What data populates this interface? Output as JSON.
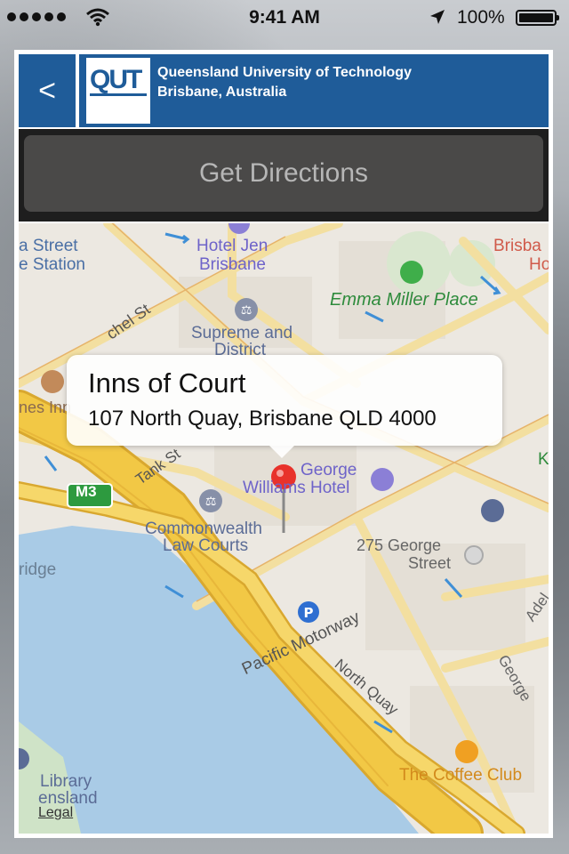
{
  "status_bar": {
    "time": "9:41 AM",
    "battery_pct": "100%",
    "icons": [
      "signal-dots",
      "wifi-icon",
      "location-arrow-icon",
      "battery-icon"
    ]
  },
  "header": {
    "back_label": "<",
    "logo_text": "QUT",
    "line1": "Queensland University of Technology",
    "line2": "Brisbane, Australia"
  },
  "directions_button": "Get Directions",
  "callout": {
    "title": "Inns of Court",
    "address": "107 North Quay, Brisbane QLD 4000"
  },
  "map": {
    "legal": "Legal",
    "labels": {
      "street_station_1": "a Street",
      "street_station_2": "e Station",
      "hotel_jen_1": "Hotel Jen",
      "hotel_jen_2": "Brisbane",
      "brisbane_cut_1": "Brisba",
      "brisbane_cut_2": "Ho",
      "emma_miller": "Emma Miller Place",
      "mitchell_st": "chel St",
      "supreme_1": "Supreme and",
      "supreme_2": "District",
      "inns_cut": "nes Inn",
      "george_williams_1": "George",
      "george_williams_2": "Williams Hotel",
      "tank_st": "Tank St",
      "m3": "M3",
      "commonwealth_1": "Commonwealth",
      "commonwealth_2": "Law Courts",
      "ridge": "ridge",
      "george_275_1": "275 George",
      "george_275_2": "Street",
      "adel": "Adel",
      "georg": "George",
      "pacific_motorway": "Pacific Motorway",
      "north_quay": "North Quay",
      "library_1": "Library",
      "library_2": "ensland",
      "coffee_club": "The Coffee Club",
      "k_cut": "K"
    }
  },
  "colors": {
    "header_blue": "#1f5c99",
    "pin_red": "#e8322b",
    "water": "#a9cbe6",
    "motorway": "#f2c845",
    "park_green": "#2e8b3c"
  }
}
